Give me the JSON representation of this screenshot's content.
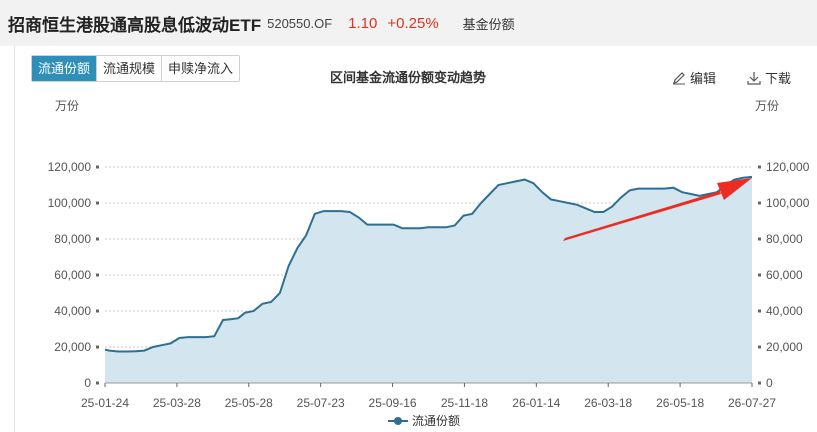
{
  "header": {
    "fund_name": "招商恒生港股通高股息低波动ETF",
    "fund_code": "520550.OF",
    "price": "1.10",
    "change": "+0.25%",
    "share_label": "基金份额"
  },
  "tabs": [
    {
      "label": "流通份额",
      "active": true
    },
    {
      "label": "流通规模",
      "active": false
    },
    {
      "label": "申赎净流入",
      "active": false
    }
  ],
  "toolbar": {
    "edit_label": "编辑",
    "download_label": "下载"
  },
  "colors": {
    "line": "#2e6f94",
    "area": "#d3e5ee",
    "arrow": "#ee2b22",
    "accent": "#2e8fb8",
    "price": "#e0331a"
  },
  "chart_data": {
    "type": "area",
    "title": "区间基金流通份额变动趋势",
    "unit_left": "万份",
    "unit_right": "万份",
    "legend": "流通份额",
    "ylim": [
      0,
      120000
    ],
    "y_ticks": [
      "0",
      "20,000",
      "40,000",
      "60,000",
      "80,000",
      "100,000",
      "120,000"
    ],
    "x_ticks": [
      "25-01-24",
      "25-03-28",
      "25-05-28",
      "25-07-23",
      "25-09-16",
      "25-11-18",
      "26-01-14",
      "26-03-18",
      "26-05-18",
      "26-07-27"
    ],
    "grid": true,
    "annotation": "red arrow pointing to latest value",
    "series": [
      {
        "values": [
          [
            0,
            18500
          ],
          [
            2,
            18000
          ],
          [
            6,
            17500
          ],
          [
            10,
            17500
          ],
          [
            14,
            17600
          ],
          [
            18,
            18000
          ],
          [
            22,
            20000
          ],
          [
            26,
            21000
          ],
          [
            30,
            22000
          ],
          [
            34,
            25000
          ],
          [
            38,
            25500
          ],
          [
            42,
            25500
          ],
          [
            46,
            25500
          ],
          [
            50,
            26000
          ],
          [
            54,
            35000
          ],
          [
            58,
            35500
          ],
          [
            61,
            36000
          ],
          [
            64,
            39000
          ],
          [
            68,
            40000
          ],
          [
            72,
            44000
          ],
          [
            76,
            45000
          ],
          [
            80,
            50000
          ],
          [
            84,
            65000
          ],
          [
            88,
            75000
          ],
          [
            92,
            82000
          ],
          [
            96,
            94000
          ],
          [
            100,
            95500
          ],
          [
            104,
            95500
          ],
          [
            108,
            95500
          ],
          [
            112,
            95000
          ],
          [
            116,
            92000
          ],
          [
            120,
            88000
          ],
          [
            124,
            88000
          ],
          [
            128,
            88000
          ],
          [
            132,
            88000
          ],
          [
            136,
            86000
          ],
          [
            140,
            86000
          ],
          [
            144,
            86000
          ],
          [
            148,
            86500
          ],
          [
            152,
            86500
          ],
          [
            156,
            86500
          ],
          [
            160,
            87500
          ],
          [
            164,
            93000
          ],
          [
            168,
            94000
          ],
          [
            172,
            100000
          ],
          [
            176,
            105000
          ],
          [
            180,
            110000
          ],
          [
            184,
            111000
          ],
          [
            188,
            112000
          ],
          [
            192,
            113000
          ],
          [
            196,
            111000
          ],
          [
            200,
            106000
          ],
          [
            204,
            102000
          ],
          [
            208,
            101000
          ],
          [
            212,
            100000
          ],
          [
            216,
            99000
          ],
          [
            220,
            97000
          ],
          [
            224,
            95000
          ],
          [
            228,
            95000
          ],
          [
            232,
            98000
          ],
          [
            236,
            103000
          ],
          [
            240,
            107000
          ],
          [
            244,
            108000
          ],
          [
            248,
            108000
          ],
          [
            252,
            108000
          ],
          [
            256,
            108000
          ],
          [
            260,
            108500
          ],
          [
            264,
            106000
          ],
          [
            268,
            105000
          ],
          [
            272,
            104000
          ],
          [
            276,
            105000
          ],
          [
            280,
            106000
          ],
          [
            284,
            110000
          ],
          [
            288,
            113000
          ],
          [
            292,
            114000
          ],
          [
            296,
            114500
          ]
        ]
      }
    ]
  }
}
